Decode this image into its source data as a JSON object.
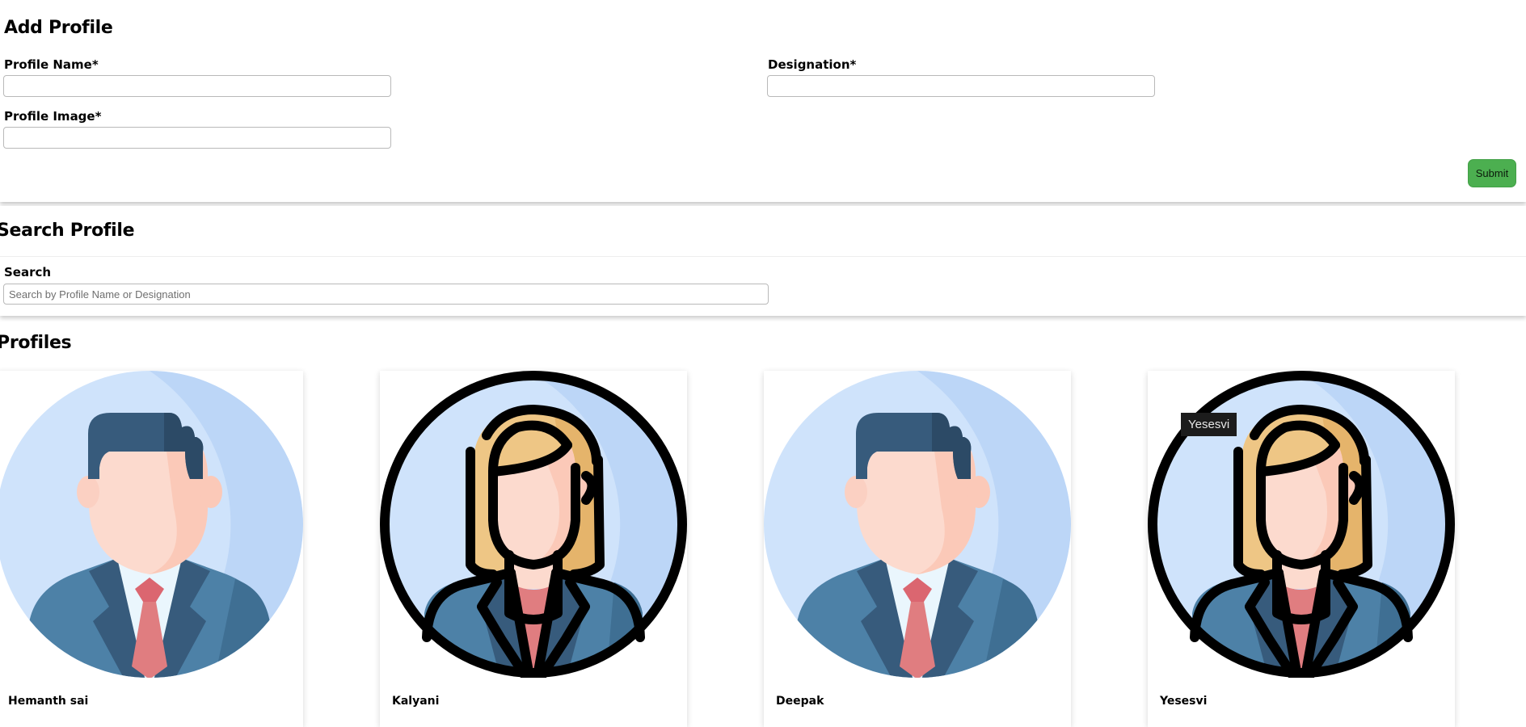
{
  "add_profile": {
    "title": "Add Profile",
    "profile_name_label": "Profile Name*",
    "profile_name_value": "",
    "designation_label": "Designation*",
    "designation_value": "",
    "profile_image_label": "Profile Image*",
    "profile_image_value": "",
    "submit_label": "Submit"
  },
  "search_profile": {
    "title": "Search Profile",
    "search_label": "Search",
    "search_placeholder": "Search by Profile Name or Designation",
    "search_value": ""
  },
  "profiles": {
    "title": "Profiles",
    "items": [
      {
        "name": "Hemanth sai",
        "avatar_icon": "male-businessman-avatar-icon"
      },
      {
        "name": "Kalyani",
        "avatar_icon": "female-businesswoman-avatar-icon"
      },
      {
        "name": "Deepak",
        "avatar_icon": "male-businessman-avatar-icon"
      },
      {
        "name": "Yesesvi",
        "avatar_icon": "female-businesswoman-avatar-icon"
      }
    ]
  },
  "tooltip": {
    "text": "Yesesvi"
  },
  "colors": {
    "submit_green": "#4caf50",
    "avatar_bg_light": "#cfe3fb",
    "avatar_bg_dark": "#bcd6f7",
    "suit_blue": "#4d81a7",
    "hair_dark": "#375b7c",
    "hair_blonde": "#eec685",
    "skin": "#fcdace",
    "tie_red": "#e07d80"
  }
}
